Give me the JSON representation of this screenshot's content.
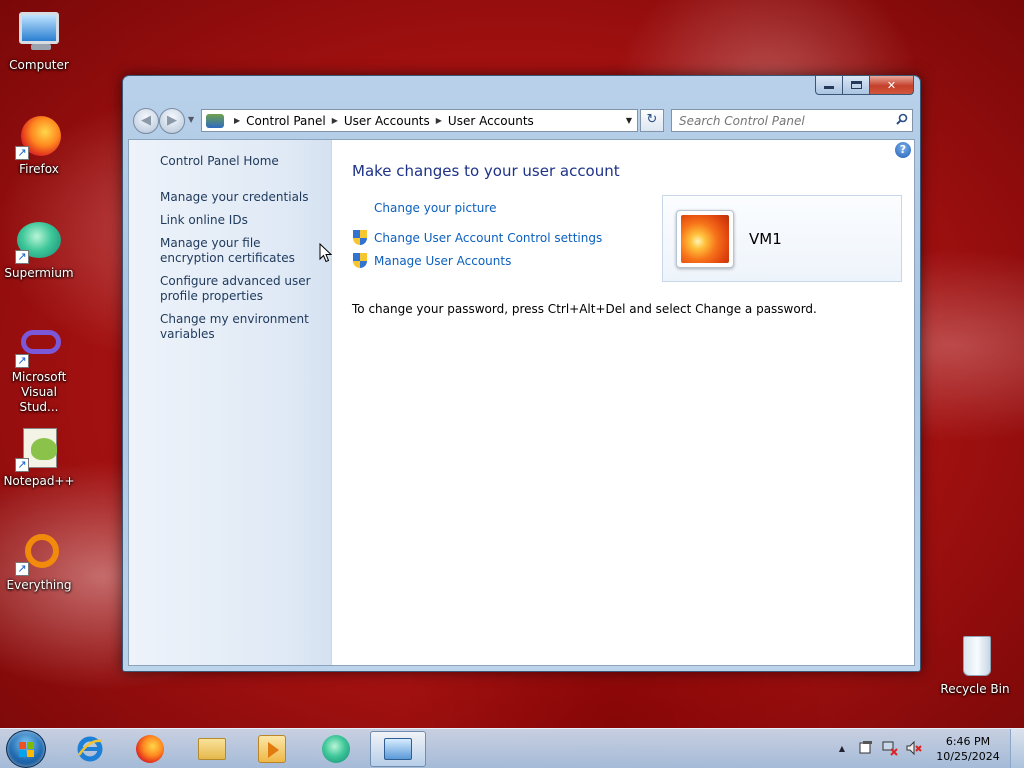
{
  "desktop": {
    "icons": [
      {
        "label": "Computer"
      },
      {
        "label": "Firefox"
      },
      {
        "label": "Supermium"
      },
      {
        "label": "Microsoft Visual Stud..."
      },
      {
        "label": "Notepad++"
      },
      {
        "label": "Everything"
      },
      {
        "label": "Recycle Bin"
      }
    ]
  },
  "window": {
    "caption": {
      "min": "minimize",
      "max": "maximize",
      "close": "✕"
    },
    "nav": {
      "back_icon": "back-arrow-icon",
      "forward_icon": "forward-arrow-icon",
      "breadcrumbs": [
        "Control Panel",
        "User Accounts",
        "User Accounts"
      ],
      "refresh_glyph": "↻",
      "search_placeholder": "Search Control Panel"
    },
    "left_pane": {
      "links": [
        "Control Panel Home",
        "Manage your credentials",
        "Link online IDs",
        "Manage your file encryption certificates",
        "Configure advanced user profile properties",
        "Change my environment variables"
      ]
    },
    "main": {
      "help": "?",
      "title": "Make changes to your user account",
      "tasks": [
        {
          "label": "Change your picture",
          "shield": false
        },
        {
          "label": "Change User Account Control settings",
          "shield": true
        },
        {
          "label": "Manage User Accounts",
          "shield": true
        }
      ],
      "password_note": "To change your password, press Ctrl+Alt+Del and select Change a password.",
      "user": {
        "name": "VM1"
      }
    }
  },
  "taskbar": {
    "pinned": [
      "Internet Explorer",
      "Firefox",
      "Windows Explorer",
      "Windows Media Player",
      "Supermium",
      "Control Panel"
    ],
    "active": "Control Panel",
    "tray": {
      "expand": "▲"
    },
    "clock": {
      "time": "6:46 PM",
      "date": "10/25/2024"
    }
  },
  "colors": {
    "link": "#0b5fbe",
    "nav_link": "#1e395b",
    "title": "#1e3287",
    "accent": "#3272d1"
  }
}
